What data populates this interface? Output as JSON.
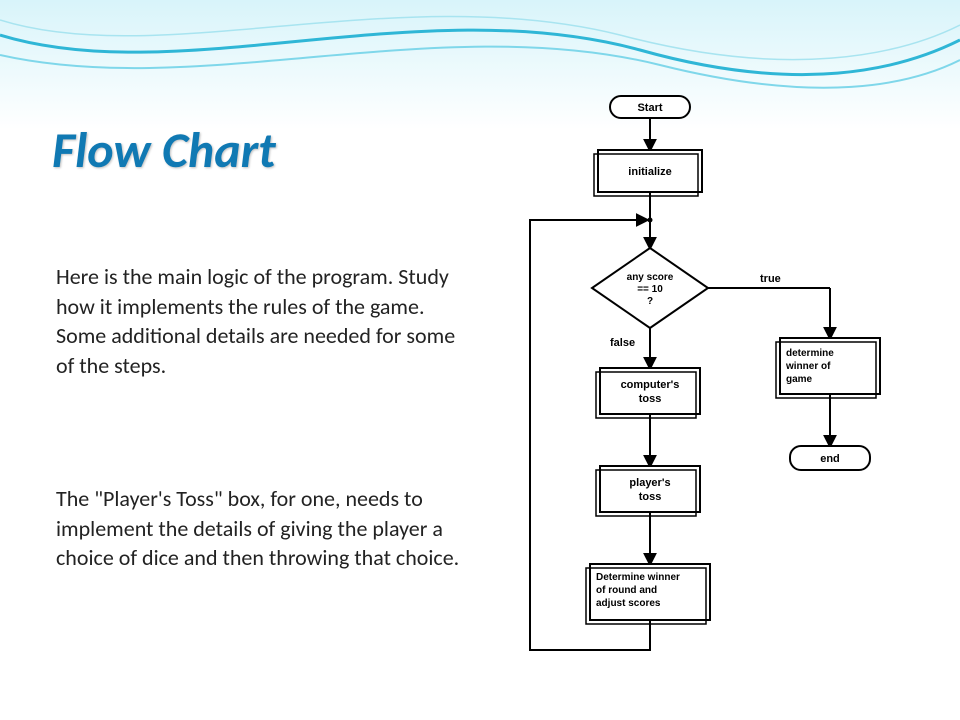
{
  "title": "Flow Chart",
  "paragraph1": "Here is the main logic of the program. Study how it implements the rules of the game. Some additional details are needed for some of the steps.",
  "paragraph2": "The \"Player's Toss\" box, for one, needs to implement the details of giving the player a choice of dice and then throwing that choice.",
  "flowchart": {
    "nodes": {
      "start": "Start",
      "initialize": "initialize",
      "decision_line1": "any score",
      "decision_line2": "== 10",
      "decision_line3": "?",
      "true_label": "true",
      "false_label": "false",
      "computers_toss_line1": "computer's",
      "computers_toss_line2": "toss",
      "players_toss_line1": "player's",
      "players_toss_line2": "toss",
      "determine_round_line1": "Determine winner",
      "determine_round_line2": "of round and",
      "determine_round_line3": "adjust scores",
      "determine_game_line1": "determine",
      "determine_game_line2": "winner of",
      "determine_game_line3": "game",
      "end": "end"
    }
  }
}
